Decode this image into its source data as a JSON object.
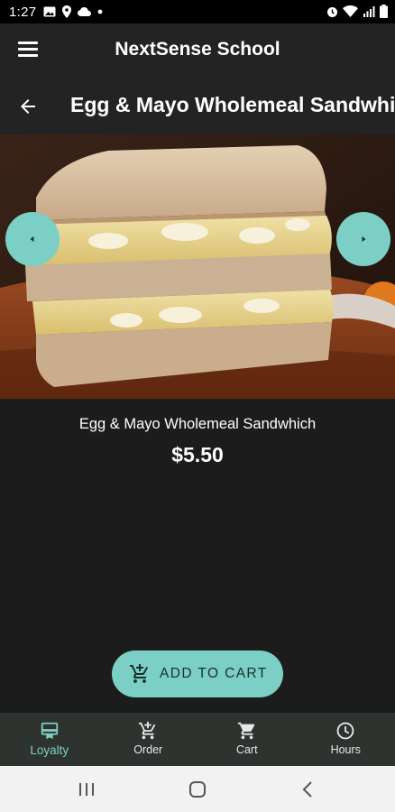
{
  "status_bar": {
    "time": "1:27"
  },
  "app_bar": {
    "title": "NextSense School"
  },
  "page": {
    "title": "Egg & Mayo Wholemeal Sandwhich"
  },
  "product": {
    "name": "Egg & Mayo Wholemeal Sandwhich",
    "price": "$5.50",
    "image_icon": "sandwich-photo"
  },
  "actions": {
    "add_to_cart": "ADD TO CART"
  },
  "bottom_nav": {
    "items": [
      {
        "label": "Loyalty",
        "icon": "loyalty-icon",
        "active": true
      },
      {
        "label": "Order",
        "icon": "order-cart-icon",
        "active": false
      },
      {
        "label": "Cart",
        "icon": "cart-icon",
        "active": false
      },
      {
        "label": "Hours",
        "icon": "clock-icon",
        "active": false
      }
    ]
  },
  "colors": {
    "accent": "#7ccfc4",
    "background": "#1c1c1c",
    "bar": "#232323",
    "nav": "#2f3330"
  }
}
